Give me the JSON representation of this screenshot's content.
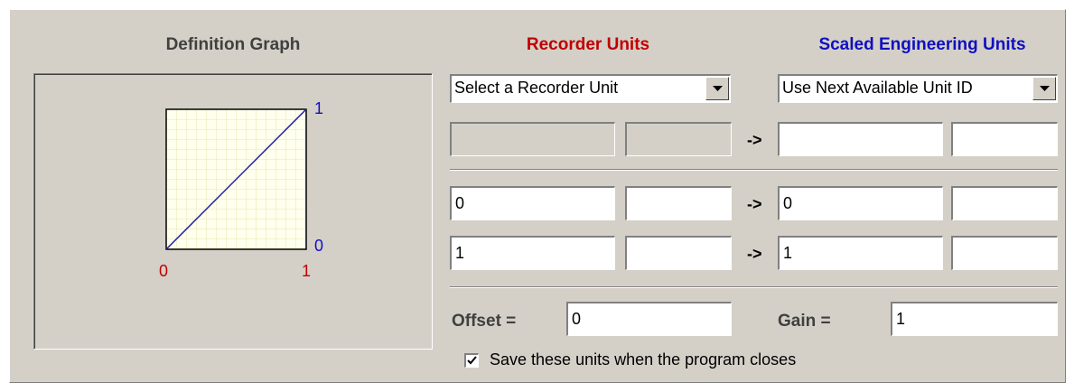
{
  "headers": {
    "definition_graph": "Definition Graph",
    "recorder_units": "Recorder Units",
    "scaled_units": "Scaled Engineering Units"
  },
  "colors": {
    "recorder": "#c00000",
    "scaled": "#1010c0",
    "graph_line": "#20209a",
    "panel": "#d4d0c8"
  },
  "graph": {
    "y_top": "1",
    "y_bottom": "0",
    "x_left": "0",
    "x_right": "1"
  },
  "recorder_select": {
    "value": "Select a Recorder Unit"
  },
  "scaled_select": {
    "value": "Use Next Available Unit ID"
  },
  "unit_row": {
    "rec_name": "",
    "rec_abbr": "",
    "arrow": "->",
    "eng_name": "",
    "eng_abbr": ""
  },
  "points": [
    {
      "rec_value": "0",
      "rec_unit": "",
      "arrow": "->",
      "eng_value": "0",
      "eng_unit": ""
    },
    {
      "rec_value": "1",
      "rec_unit": "",
      "arrow": "->",
      "eng_value": "1",
      "eng_unit": ""
    }
  ],
  "offset": {
    "label": "Offset =",
    "value": "0"
  },
  "gain": {
    "label": "Gain =",
    "value": "1"
  },
  "save_checkbox": {
    "label": "Save these units when the program closes",
    "checked": true
  }
}
